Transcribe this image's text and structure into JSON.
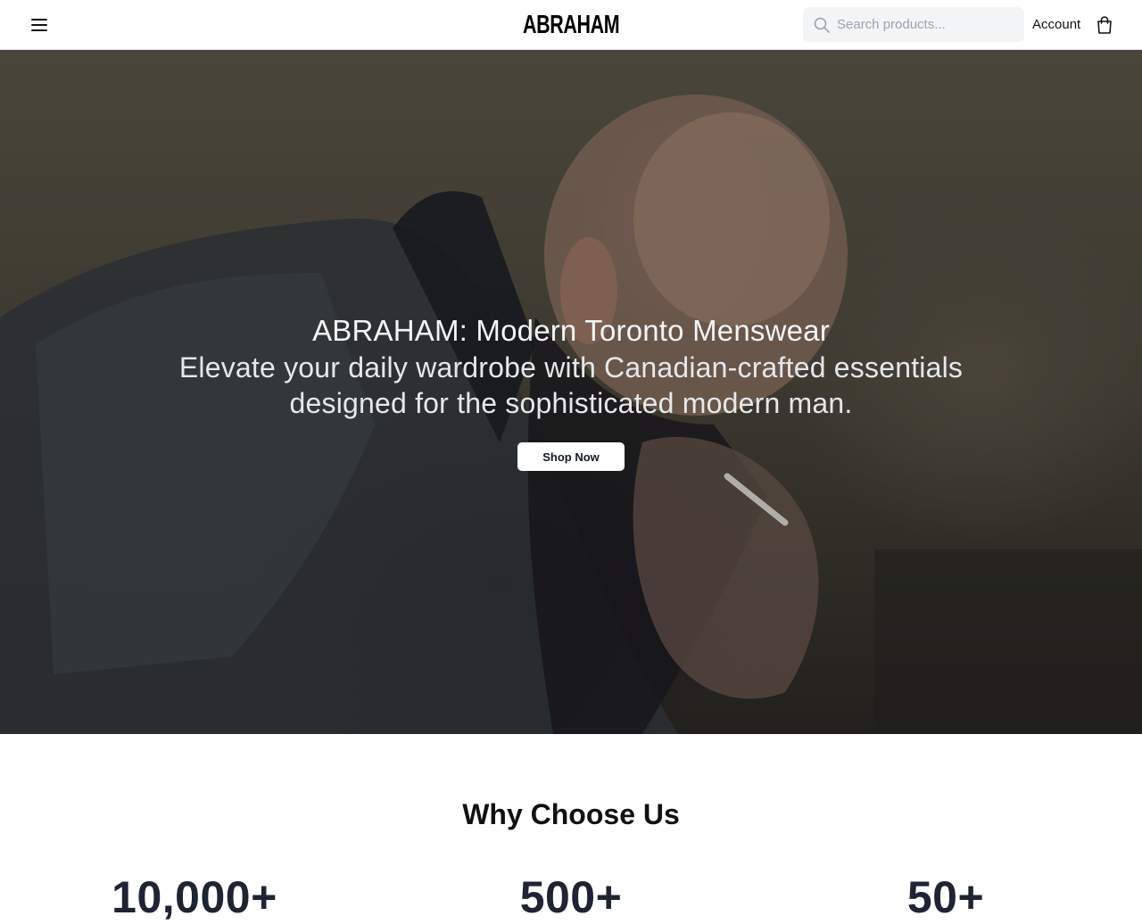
{
  "header": {
    "menu_icon": "hamburger-menu-icon",
    "logo": "ABRAHAM",
    "search": {
      "placeholder": "Search products...",
      "value": "",
      "icon": "search-icon"
    },
    "account_label": "Account",
    "cart_icon": "shopping-bag-icon"
  },
  "hero": {
    "title": "ABRAHAM: Modern Toronto Menswear",
    "subtitle": "Elevate your daily wardrobe with Canadian-crafted essentials designed for the sophisticated modern man.",
    "cta_label": "Shop Now"
  },
  "why_choose_us": {
    "title": "Why Choose Us",
    "stats": [
      {
        "value": "10,000+"
      },
      {
        "value": "500+"
      },
      {
        "value": "50+"
      }
    ]
  }
}
